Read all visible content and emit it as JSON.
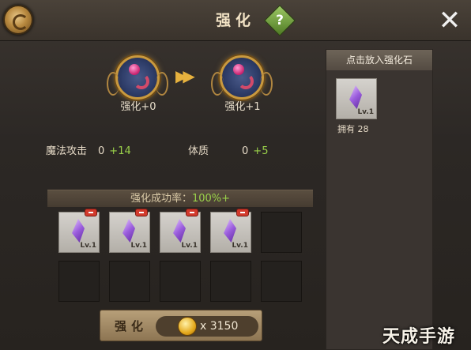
{
  "header": {
    "title": "强化",
    "help_glyph": "?",
    "close_glyph": "✕"
  },
  "upgrade": {
    "from_label": "强化+0",
    "to_label": "强化+1",
    "arrow_glyph": "▶▶"
  },
  "stats": [
    {
      "name": "魔法攻击",
      "value": "0",
      "bonus": "+14"
    },
    {
      "name": "体质",
      "value": "0",
      "bonus": "+5"
    }
  ],
  "success_rate": {
    "label": "强化成功率：",
    "value": "100%+"
  },
  "material_slots": [
    {
      "filled": true,
      "level": "Lv.1"
    },
    {
      "filled": true,
      "level": "Lv.1"
    },
    {
      "filled": true,
      "level": "Lv.1"
    },
    {
      "filled": true,
      "level": "Lv.1"
    },
    {
      "filled": false,
      "level": ""
    },
    {
      "filled": false,
      "level": ""
    },
    {
      "filled": false,
      "level": ""
    },
    {
      "filled": false,
      "level": ""
    },
    {
      "filled": false,
      "level": ""
    },
    {
      "filled": false,
      "level": ""
    }
  ],
  "enhance_button": {
    "label": "强化",
    "cost": "x 3150"
  },
  "side": {
    "header": "点击放入强化石",
    "item_level": "Lv.1",
    "owned_label": "拥有 28"
  },
  "watermark": "天成手游网",
  "colors": {
    "accent_green": "#9ad14a",
    "gold": "#e5a91c"
  }
}
